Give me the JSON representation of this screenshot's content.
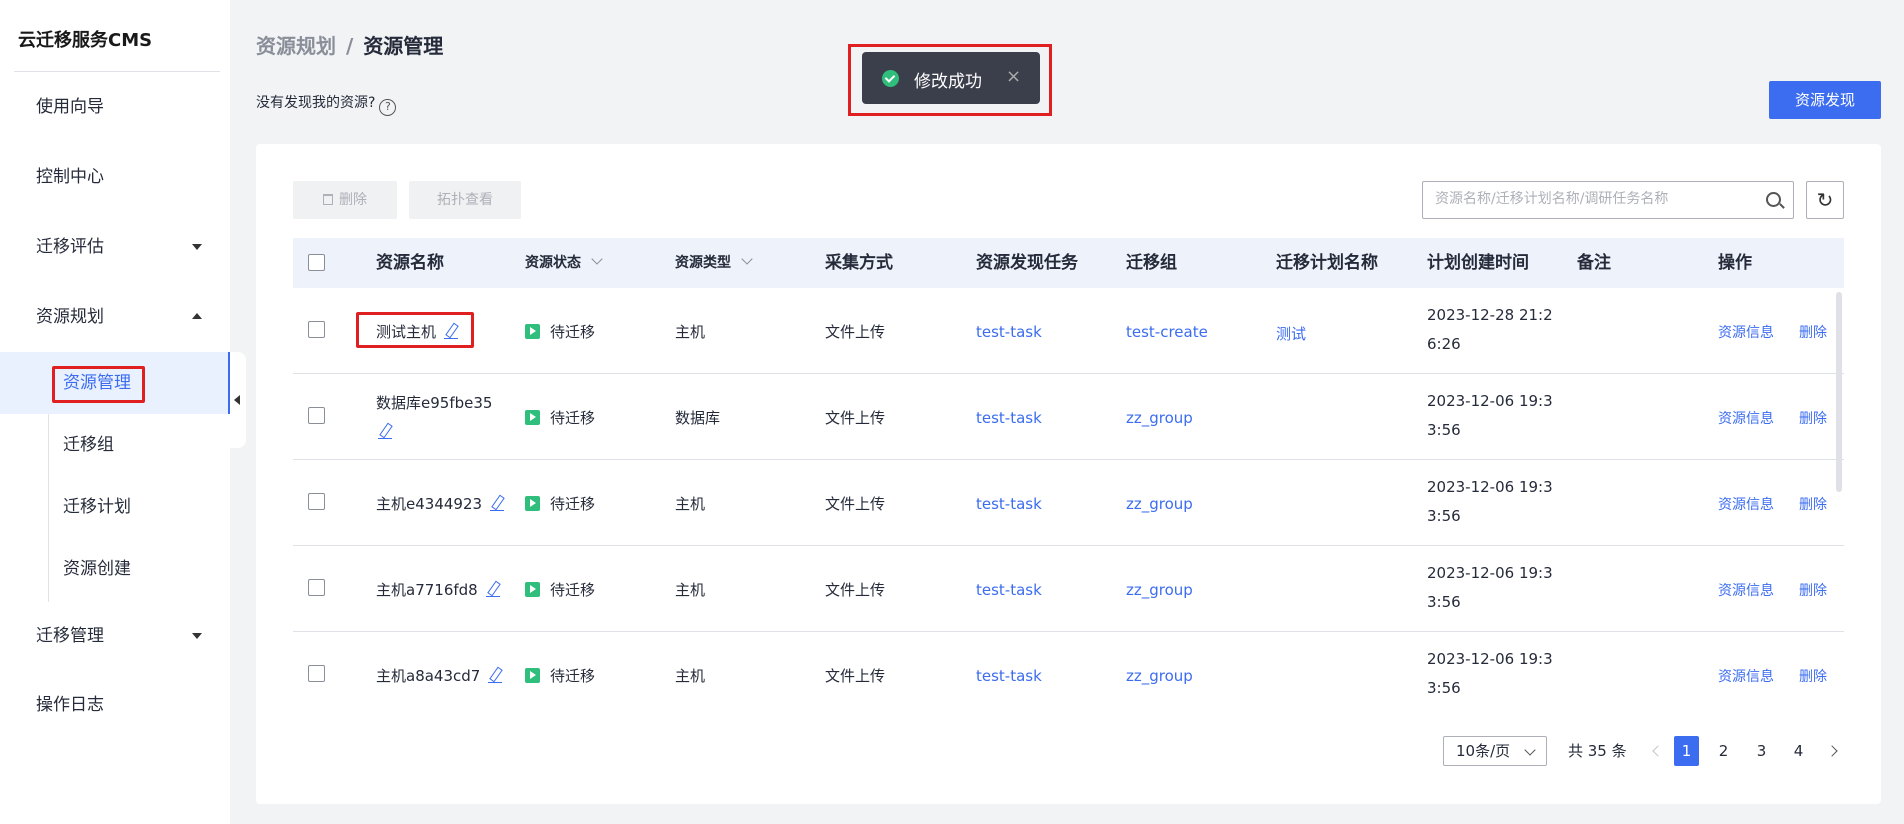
{
  "app": {
    "title": "云迁移服务CMS"
  },
  "sidebar": {
    "items": [
      {
        "label": "使用向导"
      },
      {
        "label": "控制中心"
      },
      {
        "label": "迁移评估"
      },
      {
        "label": "资源规划"
      },
      {
        "label": "迁移管理"
      },
      {
        "label": "操作日志"
      }
    ],
    "sub_items": [
      {
        "label": "资源管理"
      },
      {
        "label": "迁移组"
      },
      {
        "label": "迁移计划"
      },
      {
        "label": "资源创建"
      }
    ]
  },
  "header": {
    "breadcrumb_parent": "资源规划",
    "breadcrumb_sep": "/",
    "breadcrumb_current": "资源管理",
    "hint": "没有发现我的资源?",
    "help": "?",
    "discover_label": "资源发现"
  },
  "toast": {
    "message": "修改成功",
    "close": "×"
  },
  "toolbar": {
    "delete_label": "删除",
    "topology_label": "拓扑查看",
    "search_placeholder": "资源名称/迁移计划名称/调研任务名称",
    "refresh_icon": "refresh-icon"
  },
  "table": {
    "columns": [
      "资源名称",
      "资源状态",
      "资源类型",
      "采集方式",
      "资源发现任务",
      "迁移组",
      "迁移计划名称",
      "计划创建时间",
      "备注",
      "操作"
    ],
    "rows": [
      {
        "name": "测试主机",
        "name2": "",
        "status": "待迁移",
        "type": "主机",
        "collect": "文件上传",
        "task": "test-task",
        "group": "test-create",
        "plan": "测试",
        "time1": "2023-12-28 21:2",
        "time2": "6:26",
        "op_info": "资源信息",
        "op_delete": "删除"
      },
      {
        "name": "数据库e95fbe35",
        "name2": "",
        "status": "待迁移",
        "type": "数据库",
        "collect": "文件上传",
        "task": "test-task",
        "group": "zz_group",
        "plan": "",
        "time1": "2023-12-06 19:3",
        "time2": "3:56",
        "op_info": "资源信息",
        "op_delete": "删除"
      },
      {
        "name": "主机e4344923",
        "name2": "",
        "status": "待迁移",
        "type": "主机",
        "collect": "文件上传",
        "task": "test-task",
        "group": "zz_group",
        "plan": "",
        "time1": "2023-12-06 19:3",
        "time2": "3:56",
        "op_info": "资源信息",
        "op_delete": "删除"
      },
      {
        "name": "主机a7716fd8",
        "name2": "",
        "status": "待迁移",
        "type": "主机",
        "collect": "文件上传",
        "task": "test-task",
        "group": "zz_group",
        "plan": "",
        "time1": "2023-12-06 19:3",
        "time2": "3:56",
        "op_info": "资源信息",
        "op_delete": "删除"
      },
      {
        "name": "主机a8a43cd7",
        "name2": "",
        "status": "待迁移",
        "type": "主机",
        "collect": "文件上传",
        "task": "test-task",
        "group": "zz_group",
        "plan": "",
        "time1": "2023-12-06 19:3",
        "time2": "3:56",
        "op_info": "资源信息",
        "op_delete": "删除"
      }
    ]
  },
  "pagination": {
    "page_size": "10条/页",
    "total": "共 35 条",
    "pages": [
      "1",
      "2",
      "3",
      "4"
    ],
    "current": "1"
  },
  "colors": {
    "accent": "#3c6df0",
    "success": "#2fbe7c",
    "highlight": "#e02020"
  }
}
